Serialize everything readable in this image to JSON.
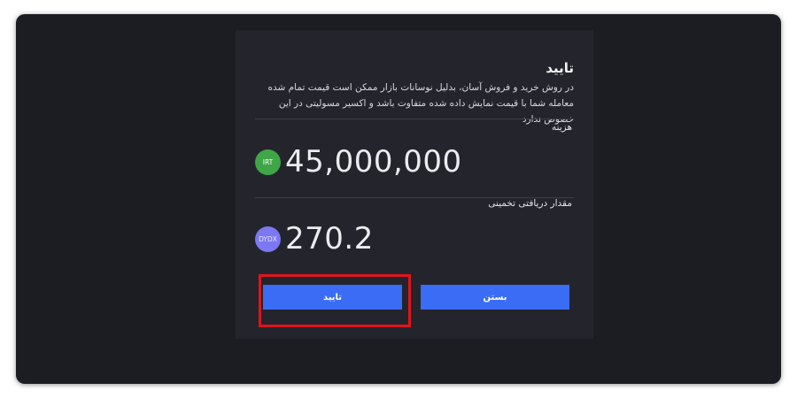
{
  "modal": {
    "title": "تایید",
    "description": "در روش خرید و فروش آسان، بدلیل نوسانات بازار ممکن است قیمت تمام شده معامله شما با قیمت نمایش داده شده متفاوت باشد و اکسیر مسولیتی در این خصوص ندارد",
    "cost": {
      "label": "هزینه",
      "coin_icon_text": "IRT",
      "coin_icon": "irt-coin-icon",
      "coin_color": "#3fa648",
      "value": "45,000,000"
    },
    "estimated_receive": {
      "label": "مقدار دریافتی تخمینی",
      "coin_icon_text": "DYDX",
      "coin_icon": "dydx-coin-icon",
      "coin_color": "#7d77f2",
      "value": "270.2"
    },
    "buttons": {
      "confirm_label": "تایید",
      "close_label": "بستن",
      "button_color": "#3a6cf5"
    }
  },
  "highlight": {
    "target": "confirm-button",
    "color": "#e0131c"
  }
}
